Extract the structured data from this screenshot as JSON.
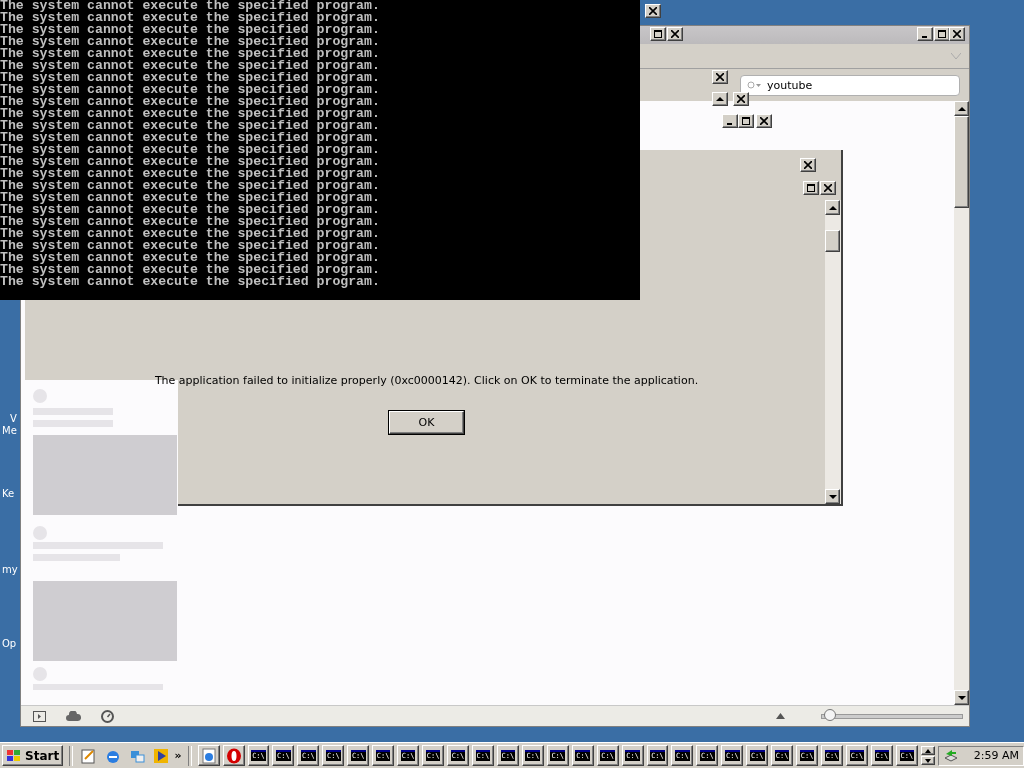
{
  "console": {
    "lines": [
      "The system cannot execute the specified program.",
      "The system cannot execute the specified program.",
      "The system cannot execute the specified program.",
      "The system cannot execute the specified program.",
      "The system cannot execute the specified program.",
      "The system cannot execute the specified program.",
      "The system cannot execute the specified program.",
      "The system cannot execute the specified program.",
      "The system cannot execute the specified program.",
      "The system cannot execute the specified program.",
      "The system cannot execute the specified program.",
      "The system cannot execute the specified program.",
      "The system cannot execute the specified program.",
      "The system cannot execute the specified program.",
      "The system cannot execute the specified program.",
      "The system cannot execute the specified program.",
      "The system cannot execute the specified program.",
      "The system cannot execute the specified program.",
      "The system cannot execute the specified program.",
      "The system cannot execute the specified program.",
      "The system cannot execute the specified program.",
      "The system cannot execute the specified program.",
      "The system cannot execute the specified program.",
      "The system cannot execute the specified program."
    ]
  },
  "desktop_icons": [
    {
      "lines": [
        "V",
        "Me"
      ]
    },
    {
      "lines": [
        "Ke"
      ]
    },
    {
      "lines": [
        "my"
      ]
    },
    {
      "lines": [
        "Op"
      ]
    }
  ],
  "ghost_buttons": [
    {
      "kind": "close"
    },
    {
      "kind": "maximize"
    },
    {
      "kind": "close"
    },
    {
      "kind": "close"
    },
    {
      "kind": "up"
    },
    {
      "kind": "close"
    },
    {
      "kind": "minimize"
    },
    {
      "kind": "maximize"
    },
    {
      "kind": "close"
    },
    {
      "kind": "close"
    },
    {
      "kind": "maximize"
    },
    {
      "kind": "close"
    }
  ],
  "browser": {
    "window_buttons": [
      {
        "kind": "minimize"
      },
      {
        "kind": "maximize"
      },
      {
        "kind": "close"
      }
    ],
    "search": {
      "value": "youtube"
    },
    "zoom": {
      "level": 0.05
    }
  },
  "dialog": {
    "message": "The application failed to initialize properly (0xc0000142). Click on OK to terminate the application.",
    "button": "OK"
  },
  "taskbar": {
    "start": "Start",
    "quick_launch": [
      {
        "kind": "notepad"
      },
      {
        "kind": "ie"
      },
      {
        "kind": "network"
      },
      {
        "kind": "media"
      }
    ],
    "more": "»",
    "tasks": [
      {
        "kind": "ie"
      },
      {
        "kind": "opera"
      },
      {
        "kind": "console",
        "icon_text": "C:\\"
      },
      {
        "kind": "console",
        "icon_text": "C:\\"
      },
      {
        "kind": "console",
        "icon_text": "C:\\"
      },
      {
        "kind": "console",
        "icon_text": "C:\\"
      },
      {
        "kind": "console",
        "icon_text": "C:\\"
      },
      {
        "kind": "console",
        "icon_text": "C:\\"
      },
      {
        "kind": "console",
        "icon_text": "C:\\"
      },
      {
        "kind": "console",
        "icon_text": "C:\\"
      },
      {
        "kind": "console",
        "icon_text": "C:\\"
      },
      {
        "kind": "console",
        "icon_text": "C:\\"
      },
      {
        "kind": "console",
        "icon_text": "C:\\"
      },
      {
        "kind": "console",
        "icon_text": "C:\\"
      },
      {
        "kind": "console",
        "icon_text": "C:\\"
      },
      {
        "kind": "console",
        "icon_text": "C:\\"
      },
      {
        "kind": "console",
        "icon_text": "C:\\"
      },
      {
        "kind": "console",
        "icon_text": "C:\\"
      },
      {
        "kind": "console",
        "icon_text": "C:\\"
      },
      {
        "kind": "console",
        "icon_text": "C:\\"
      },
      {
        "kind": "console",
        "icon_text": "C:\\"
      },
      {
        "kind": "console",
        "icon_text": "C:\\"
      },
      {
        "kind": "console",
        "icon_text": "C:\\"
      },
      {
        "kind": "console",
        "icon_text": "C:\\"
      },
      {
        "kind": "console",
        "icon_text": "C:\\"
      },
      {
        "kind": "console",
        "icon_text": "C:\\"
      },
      {
        "kind": "console",
        "icon_text": "C:\\"
      },
      {
        "kind": "console",
        "icon_text": "C:\\"
      },
      {
        "kind": "console",
        "icon_text": "C:\\"
      }
    ],
    "clock": "2:59 AM"
  }
}
